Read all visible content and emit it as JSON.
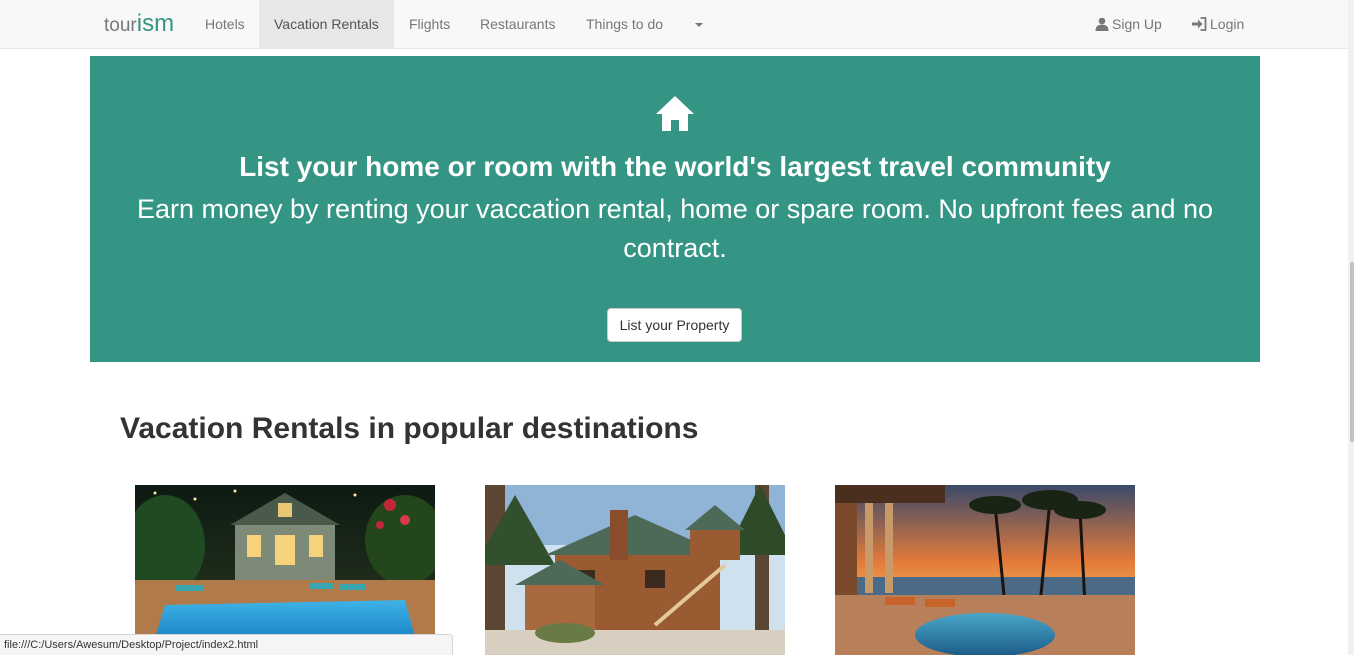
{
  "brand": {
    "prefix": "tour",
    "accent": "ism"
  },
  "nav": {
    "items": [
      {
        "label": "Hotels"
      },
      {
        "label": "Vacation Rentals"
      },
      {
        "label": "Flights"
      },
      {
        "label": "Restaurants"
      },
      {
        "label": "Things to do"
      }
    ],
    "active": "Vacation Rentals",
    "signup": "Sign Up",
    "login": "Login"
  },
  "hero": {
    "icon": "home-icon",
    "title": "List your home or room with the world's largest travel community",
    "subtitle": "Earn money by renting your vaccation rental, home or spare room. No upfront fees and no contract.",
    "button": "List your Property",
    "background": "#359585"
  },
  "section": {
    "title": "Vacation Rentals in popular destinations"
  },
  "status_bar": {
    "url": "file:///C:/Users/Awesum/Desktop/Project/index2.html"
  },
  "colors": {
    "accent": "#359585",
    "navbar_bg": "#f8f8f8",
    "active_tab_bg": "#e7e7e7"
  }
}
